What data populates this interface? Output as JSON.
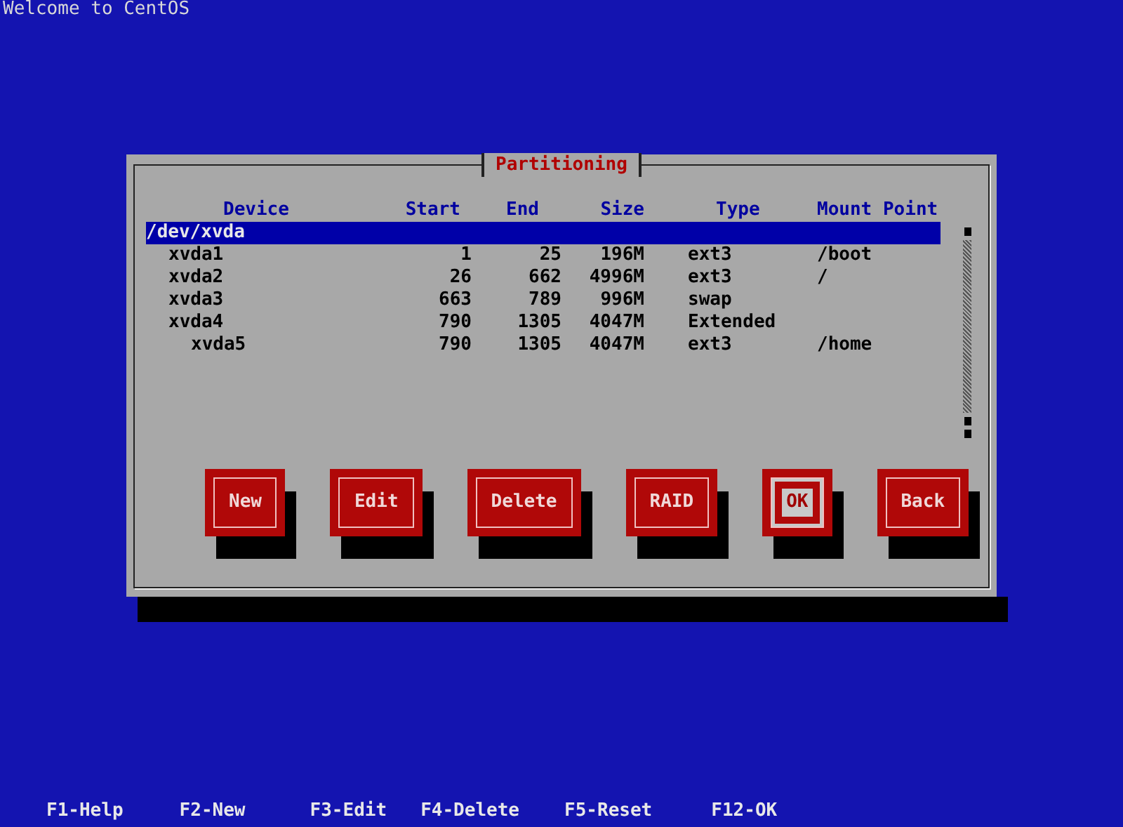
{
  "screen_title": "Welcome to CentOS",
  "dialog": {
    "title": "Partitioning",
    "columns": [
      "Device",
      "Start",
      "End",
      "Size",
      "Type",
      "Mount Point"
    ],
    "rows": [
      {
        "device": "/dev/xvda",
        "selected": true,
        "children": [
          {
            "device": "xvda1",
            "start": "1",
            "end": "25",
            "size": "196M",
            "type": "ext3",
            "mount": "/boot",
            "selected": false
          },
          {
            "device": "xvda2",
            "start": "26",
            "end": "662",
            "size": "4996M",
            "type": "ext3",
            "mount": "/",
            "selected": false
          },
          {
            "device": "xvda3",
            "start": "663",
            "end": "789",
            "size": "996M",
            "type": "swap",
            "selected": false
          },
          {
            "device": "xvda4",
            "start": "790",
            "end": "1305",
            "size": "4047M",
            "type": "Extended",
            "selected": false,
            "children": [
              {
                "device": "xvda5",
                "start": "790",
                "end": "1305",
                "size": "4047M",
                "type": "ext3",
                "mount": "/home",
                "selected": false
              }
            ]
          }
        ]
      }
    ],
    "buttons": [
      {
        "label": "New",
        "focused": false
      },
      {
        "label": "Edit",
        "focused": false
      },
      {
        "label": "Delete",
        "focused": false
      },
      {
        "label": "RAID",
        "focused": false
      },
      {
        "label": "OK",
        "focused": true
      },
      {
        "label": "Back",
        "focused": false
      }
    ]
  },
  "hotkeys": [
    "F1-Help",
    "F2-New",
    "F3-Edit",
    "F4-Delete",
    "F5-Reset",
    "F12-OK"
  ]
}
